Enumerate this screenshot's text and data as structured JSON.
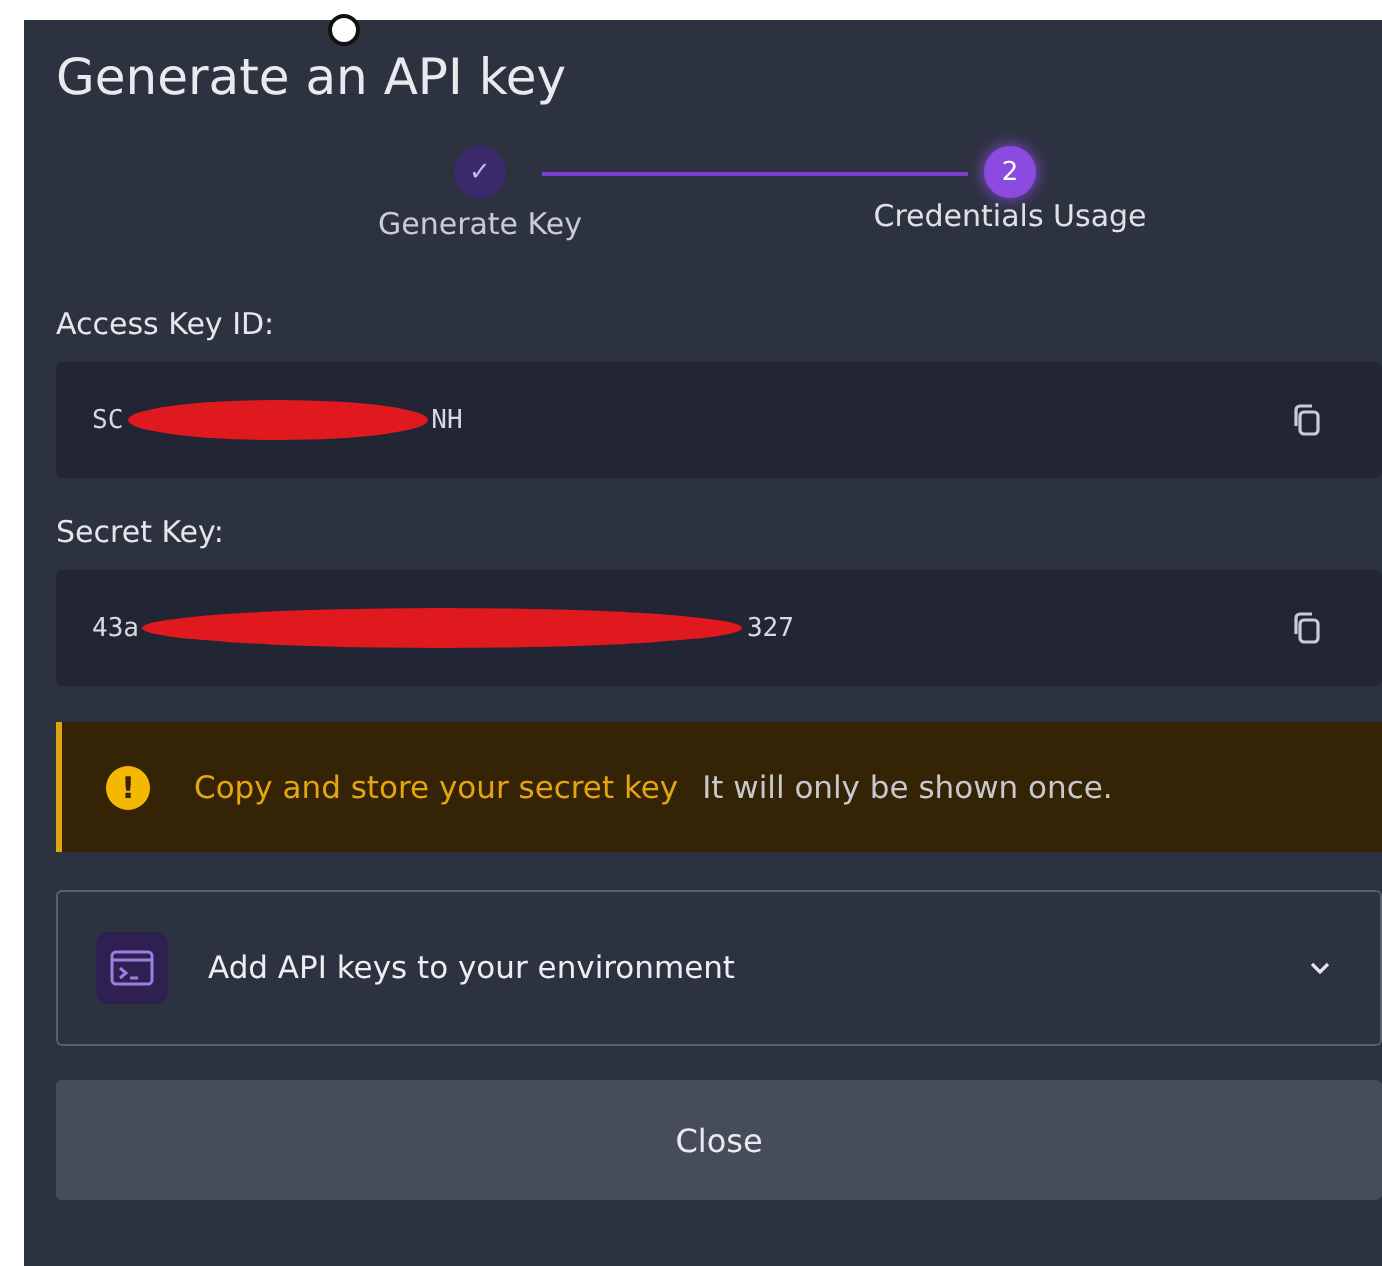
{
  "title": "Generate an API key",
  "steps": [
    {
      "number": "✓",
      "label": "Generate Key",
      "kind": "done",
      "selected": false
    },
    {
      "number": "2",
      "label": "Credentials Usage",
      "kind": "current",
      "selected": true
    }
  ],
  "fields": [
    {
      "label": "Access Key ID:",
      "prefix": "SC",
      "suffix": "NH",
      "redacted": true
    },
    {
      "label": "Secret Key:",
      "prefix": "43a",
      "suffix": "327",
      "redacted": true
    }
  ],
  "warning": {
    "icon": "!",
    "title": "Copy and store your secret key",
    "message": "It will only be shown once."
  },
  "accordion": {
    "label": "Add API keys to your environment",
    "expanded": false
  },
  "close_button": "Close"
}
